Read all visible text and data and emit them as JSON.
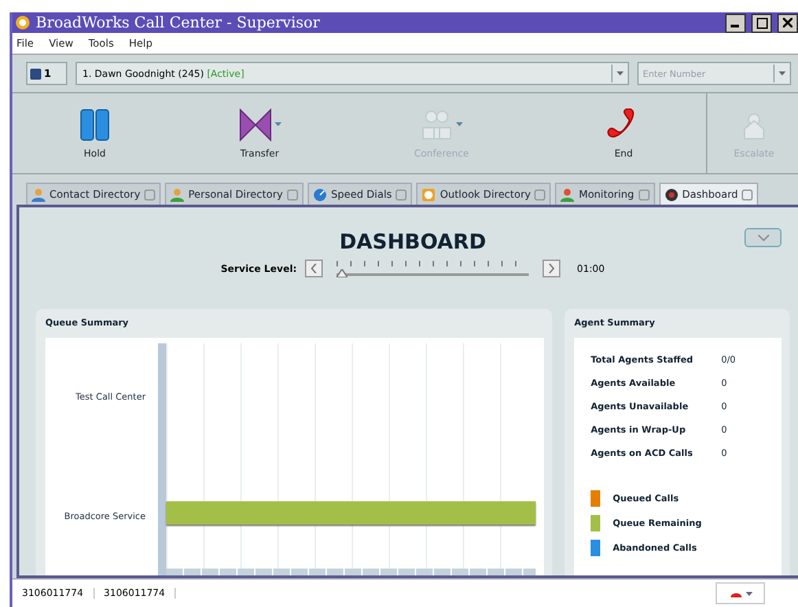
{
  "window": {
    "title": "BroadWorks Call Center - Supervisor"
  },
  "menu": [
    "File",
    "View",
    "Tools",
    "Help"
  ],
  "call_bar": {
    "line": "1",
    "call": "1. Dawn Goodnight (245) ",
    "status": "[Active]",
    "number_placeholder": "Enter Number"
  },
  "actions": [
    {
      "label": "Hold",
      "kind": "hold",
      "disabled": false,
      "dropdown": false
    },
    {
      "label": "Transfer",
      "kind": "transfer",
      "disabled": false,
      "dropdown": true
    },
    {
      "label": "Conference",
      "kind": "conference",
      "disabled": true,
      "dropdown": true
    },
    {
      "label": "End",
      "kind": "end",
      "disabled": false,
      "dropdown": false
    },
    {
      "label": "Escalate",
      "kind": "escalate",
      "disabled": true,
      "dropdown": false
    }
  ],
  "tabs": [
    {
      "label": "Contact Directory",
      "kind": "contact",
      "selected": false
    },
    {
      "label": "Personal Directory",
      "kind": "personal",
      "selected": false
    },
    {
      "label": "Speed Dials",
      "kind": "speed",
      "selected": false
    },
    {
      "label": "Outlook Directory",
      "kind": "outlook",
      "selected": false
    },
    {
      "label": "Monitoring",
      "kind": "monitoring",
      "selected": false
    },
    {
      "label": "Dashboard",
      "kind": "dashboard",
      "selected": true
    }
  ],
  "dashboard": {
    "title": "DASHBOARD",
    "service_level": {
      "label": "Service Level:",
      "level": 0,
      "reading": "01:00"
    },
    "queue_summary": {
      "title": "Queue Summary",
      "queues": [
        {
          "name": "Test Call Center"
        },
        {
          "name": "Broadcore Service",
          "level": 1
        }
      ]
    },
    "agent_summary": {
      "title": "Agent Summary",
      "stats": [
        {
          "label": "Total Agents Staffed",
          "value": "0/0"
        },
        {
          "label": "Agents Available",
          "value": "0"
        },
        {
          "label": "Agents Unavailable",
          "value": "0"
        },
        {
          "label": "Agents in Wrap-Up",
          "value": "0"
        },
        {
          "label": "Agents on ACD Calls",
          "value": "0"
        }
      ],
      "legend": [
        {
          "label": "Queued Calls",
          "color": "#e67e00"
        },
        {
          "label": "Queue Remaining",
          "color": "#a3bf48"
        },
        {
          "label": "Abandoned Calls",
          "color": "#2a8fe0"
        }
      ]
    }
  },
  "status_bar": [
    "3106011774",
    "3106011774"
  ]
}
